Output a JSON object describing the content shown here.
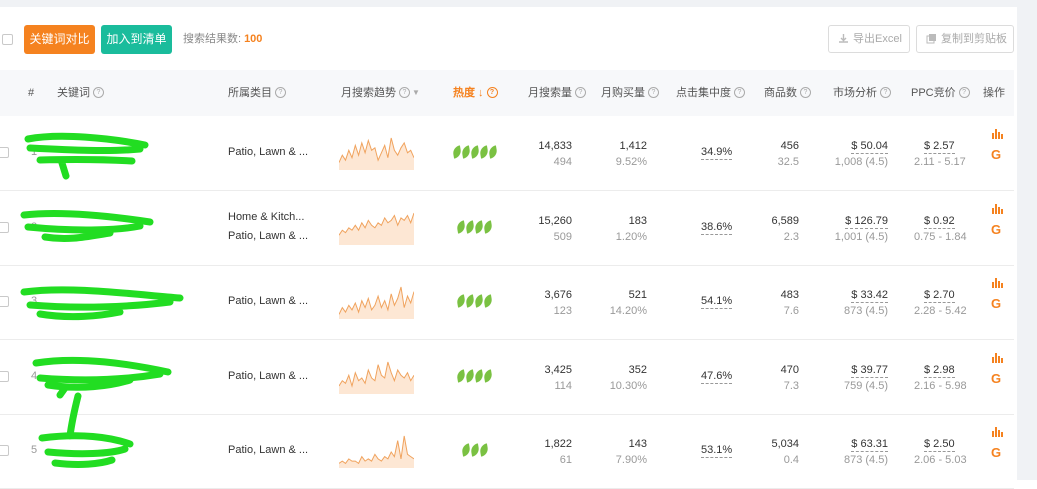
{
  "toolbar": {
    "compare_label": "关键词对比",
    "add_list_label": "加入到清单",
    "results_label": "搜索结果数:",
    "results_count": "100",
    "export_label": "导出Excel",
    "copy_label": "复制到剪贴板"
  },
  "columns": {
    "index": "#",
    "keyword": "关键词",
    "category": "所属类目",
    "trend": "月搜索趋势",
    "heat": "热度",
    "monthly_search": "月搜索量",
    "monthly_purchase": "月购买量",
    "click_concentration": "点击集中度",
    "product_count": "商品数",
    "market_analysis": "市场分析",
    "ppc": "PPC竞价",
    "actions": "操作"
  },
  "colors": {
    "accent_orange": "#f5821f",
    "accent_teal": "#1abc9c",
    "leaf_green": "#7ac142",
    "redaction_green": "#22dd22"
  },
  "rows": [
    {
      "index": "1",
      "categories": [
        "Patio, Lawn & ..."
      ],
      "heat": 5,
      "search": "14,833",
      "search_sub": "494",
      "purchase": "1,412",
      "purchase_sub": "9.52%",
      "click": "34.9%",
      "products": "456",
      "products_sub": "32.5",
      "market_price": "$ 50.04",
      "market_sub": "1,008 (4.5)",
      "ppc": "$ 2.57",
      "ppc_range": "2.11 - 5.17",
      "trend": [
        3,
        6,
        4,
        8,
        5,
        10,
        6,
        11,
        7,
        12,
        8,
        9,
        4,
        7,
        10,
        5,
        13,
        8,
        6,
        9,
        11,
        7,
        8,
        5
      ]
    },
    {
      "index": "2",
      "categories": [
        "Home & Kitch...",
        "Patio, Lawn & ..."
      ],
      "heat": 4,
      "search": "15,260",
      "search_sub": "509",
      "purchase": "183",
      "purchase_sub": "1.20%",
      "click": "38.6%",
      "products": "6,589",
      "products_sub": "2.3",
      "market_price": "$ 126.79",
      "market_sub": "1,001 (4.5)",
      "ppc": "$ 0.92",
      "ppc_range": "0.75 - 1.84",
      "trend": [
        4,
        6,
        5,
        7,
        6,
        8,
        6,
        9,
        7,
        10,
        8,
        7,
        9,
        8,
        11,
        9,
        10,
        12,
        8,
        11,
        10,
        12,
        9,
        13
      ]
    },
    {
      "index": "3",
      "categories": [
        "Patio, Lawn & ..."
      ],
      "heat": 4,
      "search": "3,676",
      "search_sub": "123",
      "purchase": "521",
      "purchase_sub": "14.20%",
      "click": "54.1%",
      "products": "483",
      "products_sub": "7.6",
      "market_price": "$ 33.42",
      "market_sub": "873 (4.5)",
      "ppc": "$ 2.70",
      "ppc_range": "2.28 - 5.42",
      "trend": [
        2,
        5,
        3,
        6,
        4,
        7,
        3,
        8,
        5,
        9,
        4,
        6,
        10,
        5,
        8,
        4,
        11,
        6,
        9,
        14,
        5,
        10,
        7,
        12
      ]
    },
    {
      "index": "4",
      "categories": [
        "Patio, Lawn & ..."
      ],
      "heat": 4,
      "search": "3,425",
      "search_sub": "114",
      "purchase": "352",
      "purchase_sub": "10.30%",
      "click": "47.6%",
      "products": "470",
      "products_sub": "7.3",
      "market_price": "$ 39.77",
      "market_sub": "759 (4.5)",
      "ppc": "$ 2.98",
      "ppc_range": "2.16 - 5.98",
      "trend": [
        3,
        5,
        4,
        7,
        3,
        8,
        5,
        6,
        4,
        9,
        6,
        5,
        11,
        7,
        6,
        12,
        8,
        5,
        9,
        7,
        6,
        8,
        5,
        7
      ]
    },
    {
      "index": "5",
      "categories": [
        "Patio, Lawn & ..."
      ],
      "heat": 3,
      "search": "1,822",
      "search_sub": "61",
      "purchase": "143",
      "purchase_sub": "7.90%",
      "click": "53.1%",
      "products": "5,034",
      "products_sub": "0.4",
      "market_price": "$ 63.31",
      "market_sub": "873 (4.5)",
      "ppc": "$ 2.50",
      "ppc_range": "2.06 - 5.03",
      "trend": [
        2,
        3,
        2,
        4,
        3,
        3,
        2,
        5,
        3,
        4,
        3,
        6,
        4,
        3,
        5,
        4,
        7,
        5,
        12,
        4,
        14,
        6,
        5,
        4
      ]
    }
  ]
}
